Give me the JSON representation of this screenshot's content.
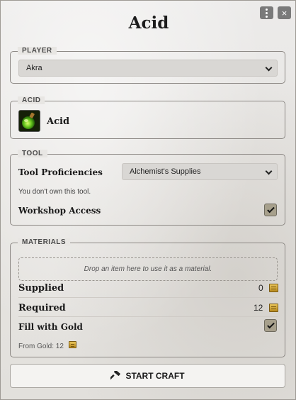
{
  "window": {
    "title": "Acid"
  },
  "header": {
    "menu_icon": "vertical-dots",
    "close_icon": "×"
  },
  "player": {
    "legend": "PLAYER",
    "selected": "Akra"
  },
  "item": {
    "legend": "ACID",
    "name": "Acid",
    "icon": "green-flask"
  },
  "tool": {
    "legend": "TOOL",
    "proficiencies_label": "Tool Proficiencies",
    "proficiencies_selected": "Alchemist's Supplies",
    "ownership_note": "You don't own this tool.",
    "workshop_label": "Workshop Access",
    "workshop_checked": true
  },
  "materials": {
    "legend": "MATERIALS",
    "dropzone_text": "Drop an item here to use it as a material.",
    "supplied_label": "Supplied",
    "supplied_value": "0",
    "required_label": "Required",
    "required_value": "12",
    "fill_gold_label": "Fill with Gold",
    "fill_gold_checked": true,
    "from_gold_text": "From Gold: 12",
    "currency_icon": "gold-coin"
  },
  "actions": {
    "start_label": "START CRAFT",
    "start_icon": "hammer"
  },
  "colors": {
    "checkbox": "#a7a08c",
    "select_bg": "#d9d7d4",
    "border": "#8c8884"
  }
}
